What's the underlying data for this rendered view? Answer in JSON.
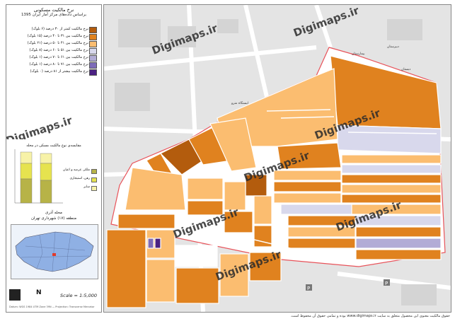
{
  "legend": {
    "title": "نرخ مالکیت مسکونی",
    "subtitle": "براساس داده‌های مرکز آمار ایران 1395",
    "items": [
      {
        "label": "نرخ مالکیت کمتر از ۳۰ درصد (۶ بلوک)",
        "color": "#b35c0d"
      },
      {
        "label": "نرخ مالکیت بین ۳۱ تا ۴۰ درصد (۱۵ بلوک)",
        "color": "#e0821f"
      },
      {
        "label": "نرخ مالکیت بین ۴۱ تا ۵۰ درصد (۲۱ بلوک)",
        "color": "#fbbd70"
      },
      {
        "label": "نرخ مالکیت بین ۵۱ تا ۶۰ درصد (۸ بلوک)",
        "color": "#d8d8ec"
      },
      {
        "label": "نرخ مالکیت بین ۶۱ تا ۷۰ درصد (۱ بلوک)",
        "color": "#b2acd6"
      },
      {
        "label": "نرخ مالکیت بین ۷۱ تا ۸۰ درصد (۱ بلوک)",
        "color": "#7d6bb8"
      },
      {
        "label": "نرخ مالکیت بیشتر از ۸۱ درصد (۰ بلوک)",
        "color": "#4b2283"
      }
    ]
  },
  "bar_chart": {
    "title": "مقایسه‌ی نوع مالکیت مسکن در محله",
    "keys": [
      {
        "label": "ملکی عرصه و اعیان",
        "color": "#b7b347"
      },
      {
        "label": "رهن، استیجاری",
        "color": "#e6e34f"
      },
      {
        "label": "سایر",
        "color": "#f7f2a8"
      }
    ]
  },
  "inset": {
    "title_line1": "محله آذری",
    "title_line2": "منطقه (۱۷) شهرداری تهران"
  },
  "scale": "Scale = 1:5,000",
  "north_label": "N",
  "credit_small": "Datum: WGS 1984 UTM Zone 39N — Projection: Transverse Mercator",
  "watermark": "Digimaps.ir",
  "footer": "حقوق مالکیت معنوی این محصول متعلق به سایت www.digimaps.ir بوده و تمامی حقوق آن محفوظ است.",
  "map_labels": {
    "label1": "ایستگاه مترو",
    "label2": "دبیرستان",
    "label3": "بیمارستان",
    "label4": "دبستان"
  }
}
